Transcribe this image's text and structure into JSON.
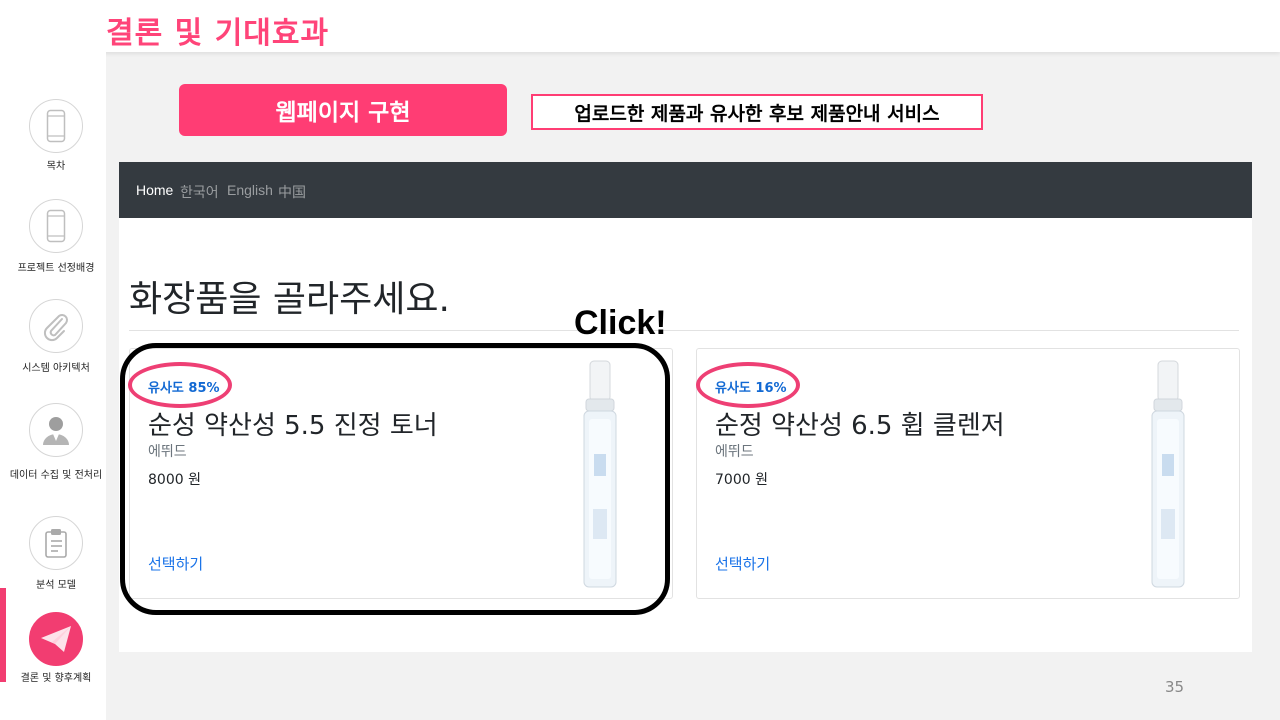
{
  "slide": {
    "title": "결론 및 기대효과",
    "section_button": "웹페이지 구현",
    "caption": "업로드한 제품과 유사한 후보 제품안내 서비스",
    "annotation": "Click!",
    "page_number": "35"
  },
  "sidebar": {
    "items": [
      {
        "label": "목차",
        "icon": "phone-icon"
      },
      {
        "label": "프로젝트 선정배경",
        "icon": "phone-icon"
      },
      {
        "label": "시스템 아키텍처",
        "icon": "paperclip-icon"
      },
      {
        "label": "데이터 수집 및 전처리",
        "icon": "person-icon"
      },
      {
        "label": "분석 모델",
        "icon": "clipboard-icon"
      },
      {
        "label": "결론 및 향후계획",
        "icon": "paper-plane-icon"
      }
    ],
    "active_index": 5
  },
  "webpage": {
    "nav": [
      "Home",
      "한국어",
      "English",
      "中国"
    ],
    "heading": "화장품을 골라주세요.",
    "cards": [
      {
        "similarity": "유사도 85%",
        "name": "순성 약산성 5.5 진정 토너",
        "brand": "에뛰드",
        "price": "8000 원",
        "action": "선택하기"
      },
      {
        "similarity": "유사도 16%",
        "name": "순정 약산성 6.5 휩 클렌저",
        "brand": "에뛰드",
        "price": "7000 원",
        "action": "선택하기"
      }
    ]
  },
  "colors": {
    "accent": "#ff3d74",
    "navbar": "#343a40",
    "link": "#1a73e8"
  }
}
